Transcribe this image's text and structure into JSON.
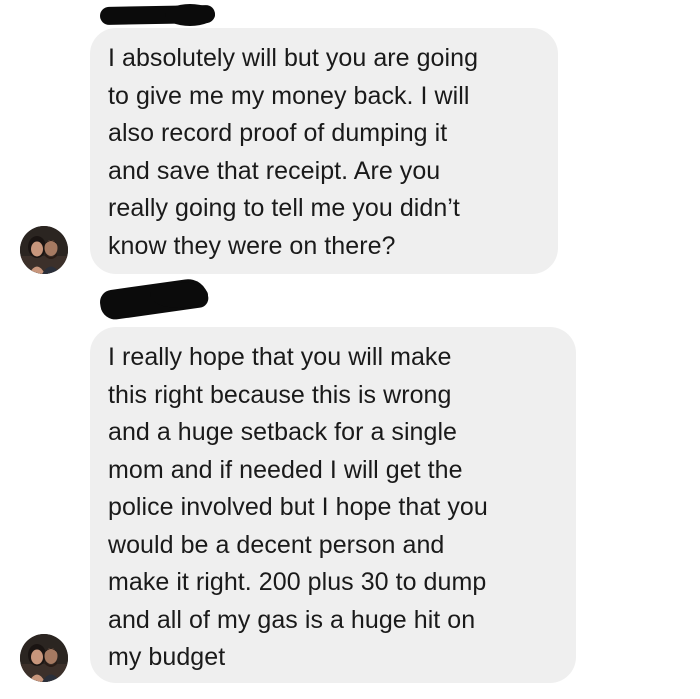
{
  "conversation": {
    "messages": [
      {
        "sender_redacted": true,
        "text": "I absolutely will but you are going\nto give me my money back. I will\nalso record proof of dumping it\nand save that receipt. Are you\nreally going to tell me you didn’t\nknow they were on there?"
      },
      {
        "sender_redacted": true,
        "text": "I really hope that you will make\nthis right because this is wrong\nand a huge setback for a single\nmom and if needed I will get the\npolice involved but I hope that you\nwould be a decent person and\nmake it right. 200 plus 30 to dump\nand all of my gas is a huge hit on\nmy budget"
      }
    ]
  },
  "colors": {
    "background": "#ffffff",
    "bubble": "#efefef",
    "text": "#1a1a1a",
    "redaction": "#0b0b0b"
  },
  "icons": {
    "avatar": "profile-photo-two-people",
    "redaction": "scribbled-out-name"
  }
}
